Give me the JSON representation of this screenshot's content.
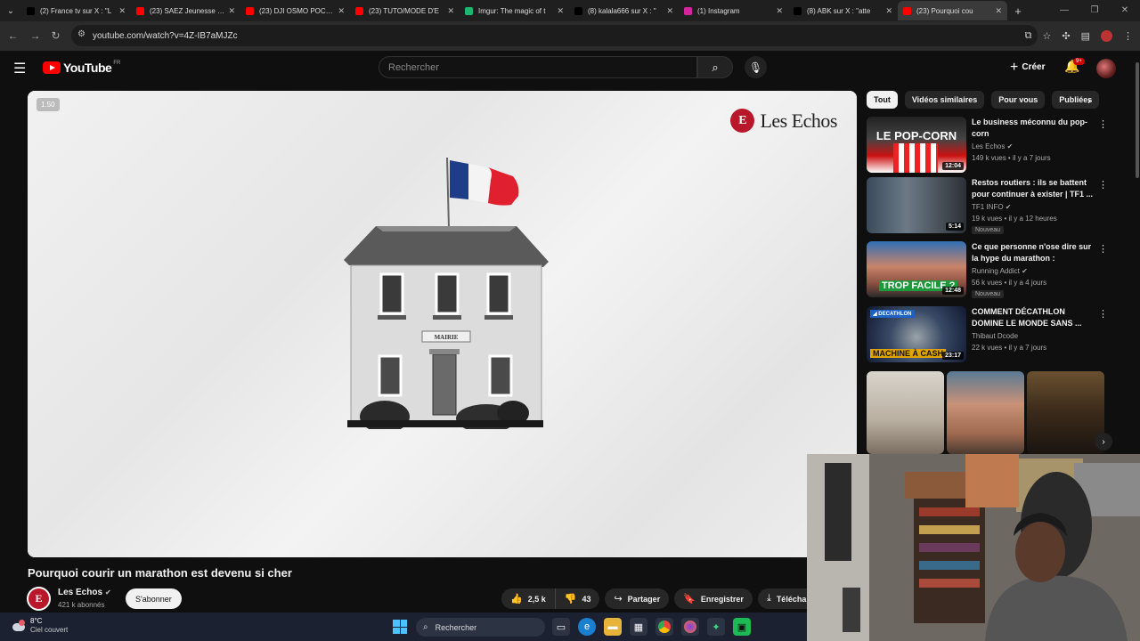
{
  "browser": {
    "tabs": [
      {
        "title": "(2) France tv sur X : \"L",
        "color": "#000000",
        "icon": "x-logo-icon",
        "active": false
      },
      {
        "title": "(23) SAEZ Jeunesse Lè",
        "color": "#ff0000",
        "icon": "youtube-icon",
        "active": false
      },
      {
        "title": "(23) DJI OSMO POCKE",
        "color": "#ff0000",
        "icon": "youtube-icon",
        "active": false
      },
      {
        "title": "(23) TUTO/MODE D'E",
        "color": "#ff0000",
        "icon": "youtube-icon",
        "active": false
      },
      {
        "title": "Imgur: The magic of t",
        "color": "#1bb76e",
        "icon": "imgur-icon",
        "active": false
      },
      {
        "title": "(8) kalala666 sur X : \"",
        "color": "#000000",
        "icon": "x-logo-icon",
        "active": false
      },
      {
        "title": "(1) Instagram",
        "color": "#d6249f",
        "icon": "instagram-icon",
        "active": false
      },
      {
        "title": "(8) ABK sur X : \"atte",
        "color": "#000000",
        "icon": "x-logo-icon",
        "active": false
      },
      {
        "title": "(23) Pourquoi cou",
        "color": "#ff0000",
        "icon": "youtube-icon",
        "active": true
      }
    ],
    "url": "youtube.com/watch?v=4Z-IB7aMJZc"
  },
  "header": {
    "logo_text": "YouTube",
    "logo_region": "FR",
    "search_placeholder": "Rechercher",
    "create_label": "Créer",
    "notif_badge": "9+"
  },
  "player": {
    "speed_label": "1.50",
    "brand": "Les Echos",
    "sign_text": "MAIRIE"
  },
  "video": {
    "title": "Pourquoi courir un marathon est devenu si cher",
    "channel": "Les Echos",
    "subscribers": "421 k abonnés",
    "subscribe_label": "S'abonner",
    "likes": "2,5 k",
    "dislikes": "43",
    "share_label": "Partager",
    "save_label": "Enregistrer",
    "download_label": "Télécharger"
  },
  "chips": [
    "Tout",
    "Vidéos similaires",
    "Pour vous",
    "Publiées"
  ],
  "recommendations": [
    {
      "title": "Le business méconnu du pop-corn",
      "channel": "Les Echos",
      "meta": "149 k vues • il y a 7 jours",
      "duration": "12:04",
      "thumb_caption": "LE POP-CORN",
      "badge": ""
    },
    {
      "title": "Restos routiers : ils se battent pour continuer à exister | TF1 ...",
      "channel": "TF1 INFO",
      "meta": "19 k vues • il y a 12 heures",
      "duration": "5:14",
      "thumb_caption": "",
      "badge": "Nouveau"
    },
    {
      "title": "Ce que personne n'ose dire sur la hype du marathon :",
      "channel": "Running Addict",
      "meta": "56 k vues • il y a 4 jours",
      "duration": "12:48",
      "thumb_caption": "TROP FACILE ?",
      "badge": "Nouveau"
    },
    {
      "title": "COMMENT DÉCATHLON DOMINE LE MONDE SANS ...",
      "channel": "Thibaut Dcode",
      "meta": "22 k vues • il y a 7 jours",
      "duration": "23:17",
      "thumb_caption": "MACHINE À CASH",
      "badge": ""
    }
  ],
  "taskbar": {
    "temperature": "8°C",
    "weather": "Ciel couvert",
    "search_label": "Rechercher"
  }
}
